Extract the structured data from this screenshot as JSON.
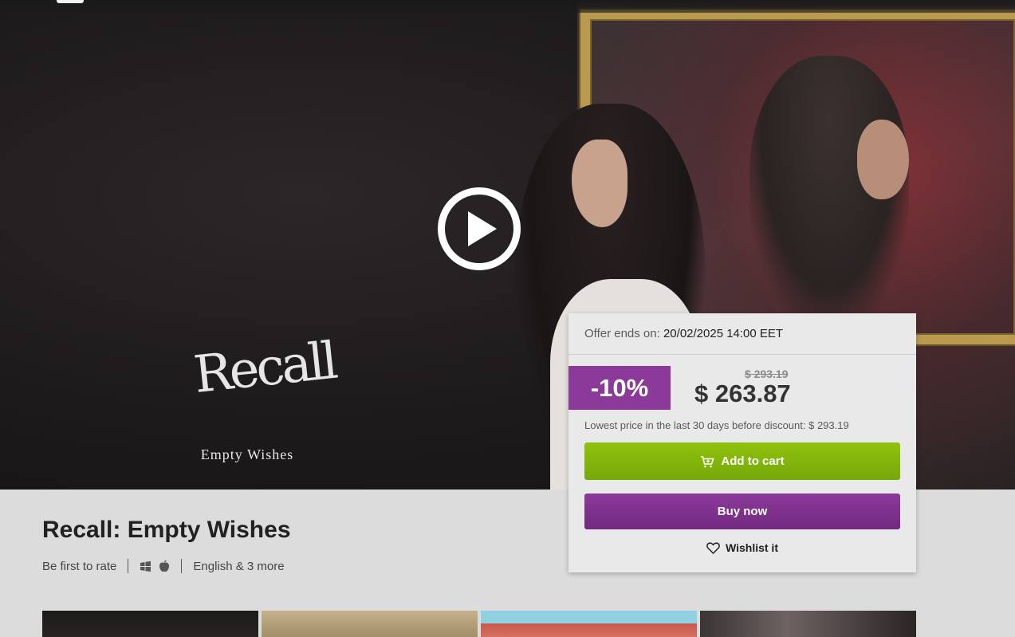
{
  "hero": {
    "logo_title": "Recall",
    "logo_subtitle": "Empty Wishes",
    "play_icon": "play-icon"
  },
  "product": {
    "title": "Recall: Empty Wishes",
    "rating_text": "Be first to rate",
    "platform_icons": [
      "windows-icon",
      "apple-icon"
    ],
    "languages": "English & 3 more"
  },
  "purchase": {
    "offer_label": "Offer ends on:",
    "offer_date": "20/02/2025 14:00 EET",
    "discount": "-10%",
    "old_price": "$ 293.19",
    "new_price": "$ 263.87",
    "lowest_price_text": "Lowest price in the last 30 days before discount: $ 293.19",
    "add_to_cart_label": "Add to cart",
    "buy_now_label": "Buy now",
    "wishlist_label": "Wishlist it"
  },
  "colors": {
    "purple": "#8c3a9a",
    "green": "#8fc20d",
    "background": "#dcdcdc"
  }
}
